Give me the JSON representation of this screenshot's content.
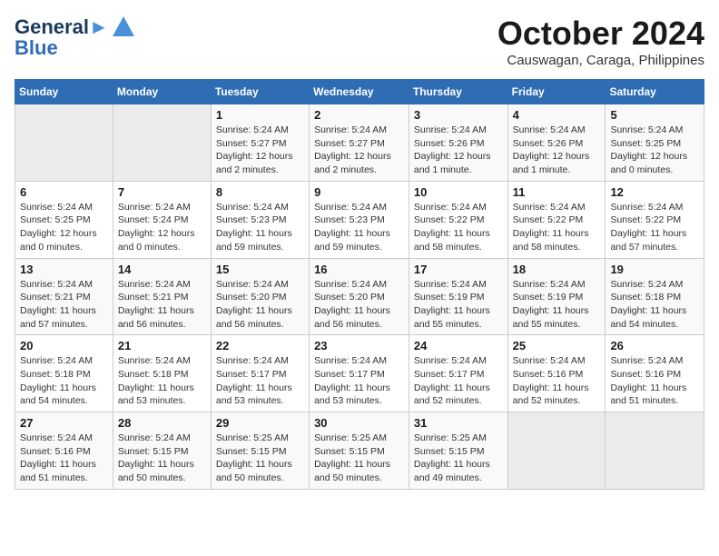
{
  "header": {
    "logo_line1": "General",
    "logo_line2": "Blue",
    "month": "October 2024",
    "location": "Causwagan, Caraga, Philippines"
  },
  "weekdays": [
    "Sunday",
    "Monday",
    "Tuesday",
    "Wednesday",
    "Thursday",
    "Friday",
    "Saturday"
  ],
  "weeks": [
    [
      {
        "day": "",
        "info": ""
      },
      {
        "day": "",
        "info": ""
      },
      {
        "day": "1",
        "info": "Sunrise: 5:24 AM\nSunset: 5:27 PM\nDaylight: 12 hours\nand 2 minutes."
      },
      {
        "day": "2",
        "info": "Sunrise: 5:24 AM\nSunset: 5:27 PM\nDaylight: 12 hours\nand 2 minutes."
      },
      {
        "day": "3",
        "info": "Sunrise: 5:24 AM\nSunset: 5:26 PM\nDaylight: 12 hours\nand 1 minute."
      },
      {
        "day": "4",
        "info": "Sunrise: 5:24 AM\nSunset: 5:26 PM\nDaylight: 12 hours\nand 1 minute."
      },
      {
        "day": "5",
        "info": "Sunrise: 5:24 AM\nSunset: 5:25 PM\nDaylight: 12 hours\nand 0 minutes."
      }
    ],
    [
      {
        "day": "6",
        "info": "Sunrise: 5:24 AM\nSunset: 5:25 PM\nDaylight: 12 hours\nand 0 minutes."
      },
      {
        "day": "7",
        "info": "Sunrise: 5:24 AM\nSunset: 5:24 PM\nDaylight: 12 hours\nand 0 minutes."
      },
      {
        "day": "8",
        "info": "Sunrise: 5:24 AM\nSunset: 5:23 PM\nDaylight: 11 hours\nand 59 minutes."
      },
      {
        "day": "9",
        "info": "Sunrise: 5:24 AM\nSunset: 5:23 PM\nDaylight: 11 hours\nand 59 minutes."
      },
      {
        "day": "10",
        "info": "Sunrise: 5:24 AM\nSunset: 5:22 PM\nDaylight: 11 hours\nand 58 minutes."
      },
      {
        "day": "11",
        "info": "Sunrise: 5:24 AM\nSunset: 5:22 PM\nDaylight: 11 hours\nand 58 minutes."
      },
      {
        "day": "12",
        "info": "Sunrise: 5:24 AM\nSunset: 5:22 PM\nDaylight: 11 hours\nand 57 minutes."
      }
    ],
    [
      {
        "day": "13",
        "info": "Sunrise: 5:24 AM\nSunset: 5:21 PM\nDaylight: 11 hours\nand 57 minutes."
      },
      {
        "day": "14",
        "info": "Sunrise: 5:24 AM\nSunset: 5:21 PM\nDaylight: 11 hours\nand 56 minutes."
      },
      {
        "day": "15",
        "info": "Sunrise: 5:24 AM\nSunset: 5:20 PM\nDaylight: 11 hours\nand 56 minutes."
      },
      {
        "day": "16",
        "info": "Sunrise: 5:24 AM\nSunset: 5:20 PM\nDaylight: 11 hours\nand 56 minutes."
      },
      {
        "day": "17",
        "info": "Sunrise: 5:24 AM\nSunset: 5:19 PM\nDaylight: 11 hours\nand 55 minutes."
      },
      {
        "day": "18",
        "info": "Sunrise: 5:24 AM\nSunset: 5:19 PM\nDaylight: 11 hours\nand 55 minutes."
      },
      {
        "day": "19",
        "info": "Sunrise: 5:24 AM\nSunset: 5:18 PM\nDaylight: 11 hours\nand 54 minutes."
      }
    ],
    [
      {
        "day": "20",
        "info": "Sunrise: 5:24 AM\nSunset: 5:18 PM\nDaylight: 11 hours\nand 54 minutes."
      },
      {
        "day": "21",
        "info": "Sunrise: 5:24 AM\nSunset: 5:18 PM\nDaylight: 11 hours\nand 53 minutes."
      },
      {
        "day": "22",
        "info": "Sunrise: 5:24 AM\nSunset: 5:17 PM\nDaylight: 11 hours\nand 53 minutes."
      },
      {
        "day": "23",
        "info": "Sunrise: 5:24 AM\nSunset: 5:17 PM\nDaylight: 11 hours\nand 53 minutes."
      },
      {
        "day": "24",
        "info": "Sunrise: 5:24 AM\nSunset: 5:17 PM\nDaylight: 11 hours\nand 52 minutes."
      },
      {
        "day": "25",
        "info": "Sunrise: 5:24 AM\nSunset: 5:16 PM\nDaylight: 11 hours\nand 52 minutes."
      },
      {
        "day": "26",
        "info": "Sunrise: 5:24 AM\nSunset: 5:16 PM\nDaylight: 11 hours\nand 51 minutes."
      }
    ],
    [
      {
        "day": "27",
        "info": "Sunrise: 5:24 AM\nSunset: 5:16 PM\nDaylight: 11 hours\nand 51 minutes."
      },
      {
        "day": "28",
        "info": "Sunrise: 5:24 AM\nSunset: 5:15 PM\nDaylight: 11 hours\nand 50 minutes."
      },
      {
        "day": "29",
        "info": "Sunrise: 5:25 AM\nSunset: 5:15 PM\nDaylight: 11 hours\nand 50 minutes."
      },
      {
        "day": "30",
        "info": "Sunrise: 5:25 AM\nSunset: 5:15 PM\nDaylight: 11 hours\nand 50 minutes."
      },
      {
        "day": "31",
        "info": "Sunrise: 5:25 AM\nSunset: 5:15 PM\nDaylight: 11 hours\nand 49 minutes."
      },
      {
        "day": "",
        "info": ""
      },
      {
        "day": "",
        "info": ""
      }
    ]
  ]
}
